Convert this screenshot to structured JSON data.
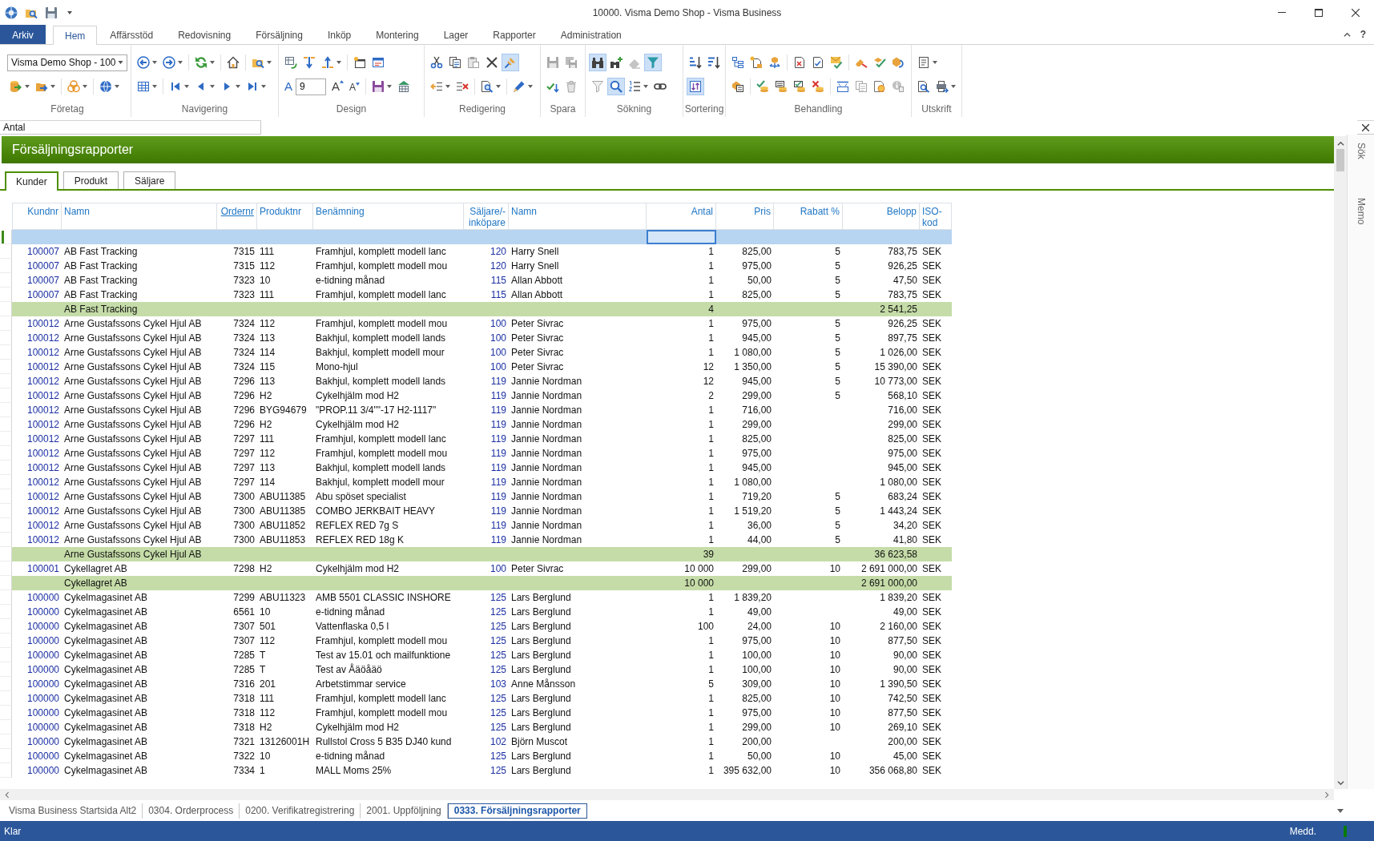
{
  "window": {
    "title": "10000. Visma Demo Shop - Visma Business"
  },
  "ribbon": {
    "tabs": [
      {
        "label": "Arkiv",
        "kind": "backstage",
        "selected": false
      },
      {
        "label": "Hem",
        "kind": "tab",
        "selected": true
      },
      {
        "label": "Affärsstöd",
        "kind": "tab",
        "selected": false
      },
      {
        "label": "Redovisning",
        "kind": "tab",
        "selected": false
      },
      {
        "label": "Försäljning",
        "kind": "tab",
        "selected": false
      },
      {
        "label": "Inköp",
        "kind": "tab",
        "selected": false
      },
      {
        "label": "Montering",
        "kind": "tab",
        "selected": false
      },
      {
        "label": "Lager",
        "kind": "tab",
        "selected": false
      },
      {
        "label": "Rapporter",
        "kind": "tab",
        "selected": false
      },
      {
        "label": "Administration",
        "kind": "tab",
        "selected": false
      }
    ],
    "help_button": "?",
    "company_select": {
      "value": "Visma Demo Shop - 100"
    },
    "font_buttons": [
      "A",
      "A",
      "A"
    ],
    "font_size_field": {
      "value": "9"
    },
    "groups": [
      "Företag",
      "Navigering",
      "Design",
      "Redigering",
      "Spara",
      "Sökning",
      "Sortering",
      "Behandling",
      "Utskrift"
    ]
  },
  "field_bar": {
    "name_box": {
      "value": "Antal"
    }
  },
  "panel": {
    "title": "Försäljningsrapporter",
    "tabs": [
      {
        "label": "Kunder",
        "selected": true
      },
      {
        "label": "Produkt",
        "selected": false
      },
      {
        "label": "Säljare",
        "selected": false
      }
    ],
    "table": {
      "columns": [
        {
          "label": "Kundnr",
          "sorted": false,
          "filter_focused": false
        },
        {
          "label": "Namn",
          "sorted": false,
          "filter_focused": false
        },
        {
          "label": "Ordernr",
          "sorted": true,
          "filter_focused": false
        },
        {
          "label": "Produktnr",
          "sorted": false,
          "filter_focused": false
        },
        {
          "label": "Benämning",
          "sorted": false,
          "filter_focused": false
        },
        {
          "label": "Säljare/-inköpare",
          "sorted": false,
          "filter_focused": false
        },
        {
          "label": "Namn",
          "sorted": false,
          "filter_focused": false
        },
        {
          "label": "Antal",
          "sorted": false,
          "filter_focused": true
        },
        {
          "label": "Pris",
          "sorted": false,
          "filter_focused": false
        },
        {
          "label": "Rabatt %",
          "sorted": false,
          "filter_focused": false
        },
        {
          "label": "Belopp",
          "sorted": false,
          "filter_focused": false
        },
        {
          "label": "ISO-kod",
          "sorted": false,
          "filter_focused": false
        }
      ],
      "rows": [
        {
          "kind": "line",
          "kundnr": "100007",
          "namn": "AB Fast Tracking",
          "ordernr": "7315",
          "produktnr": "111",
          "benamning": "Framhjul, komplett modell lanc",
          "saljare": "120",
          "saljare_namn": "Harry Snell",
          "antal": "1",
          "pris": "825,00",
          "rabatt": "5",
          "belopp": "783,75",
          "iso_kod": "SEK"
        },
        {
          "kind": "line",
          "kundnr": "100007",
          "namn": "AB Fast Tracking",
          "ordernr": "7315",
          "produktnr": "112",
          "benamning": "Framhjul, komplett modell mou",
          "saljare": "120",
          "saljare_namn": "Harry Snell",
          "antal": "1",
          "pris": "975,00",
          "rabatt": "5",
          "belopp": "926,25",
          "iso_kod": "SEK"
        },
        {
          "kind": "line",
          "kundnr": "100007",
          "namn": "AB Fast Tracking",
          "ordernr": "7323",
          "produktnr": "10",
          "benamning": "e-tidning månad",
          "saljare": "115",
          "saljare_namn": "Allan Abbott",
          "antal": "1",
          "pris": "50,00",
          "rabatt": "5",
          "belopp": "47,50",
          "iso_kod": "SEK"
        },
        {
          "kind": "line",
          "kundnr": "100007",
          "namn": "AB Fast Tracking",
          "ordernr": "7323",
          "produktnr": "111",
          "benamning": "Framhjul, komplett modell lanc",
          "saljare": "115",
          "saljare_namn": "Allan Abbott",
          "antal": "1",
          "pris": "825,00",
          "rabatt": "5",
          "belopp": "783,75",
          "iso_kod": "SEK"
        },
        {
          "kind": "subtotal",
          "namn": "AB Fast Tracking",
          "antal": "4",
          "belopp": "2 541,25"
        },
        {
          "kind": "line",
          "kundnr": "100012",
          "namn": "Arne Gustafssons Cykel Hjul AB",
          "ordernr": "7324",
          "produktnr": "112",
          "benamning": "Framhjul, komplett modell mou",
          "saljare": "100",
          "saljare_namn": "Peter Sivrac",
          "antal": "1",
          "pris": "975,00",
          "rabatt": "5",
          "belopp": "926,25",
          "iso_kod": "SEK"
        },
        {
          "kind": "line",
          "kundnr": "100012",
          "namn": "Arne Gustafssons Cykel Hjul AB",
          "ordernr": "7324",
          "produktnr": "113",
          "benamning": "Bakhjul, komplett modell lands",
          "saljare": "100",
          "saljare_namn": "Peter Sivrac",
          "antal": "1",
          "pris": "945,00",
          "rabatt": "5",
          "belopp": "897,75",
          "iso_kod": "SEK"
        },
        {
          "kind": "line",
          "kundnr": "100012",
          "namn": "Arne Gustafssons Cykel Hjul AB",
          "ordernr": "7324",
          "produktnr": "114",
          "benamning": "Bakhjul, komplett modell mour",
          "saljare": "100",
          "saljare_namn": "Peter Sivrac",
          "antal": "1",
          "pris": "1 080,00",
          "rabatt": "5",
          "belopp": "1 026,00",
          "iso_kod": "SEK"
        },
        {
          "kind": "line",
          "kundnr": "100012",
          "namn": "Arne Gustafssons Cykel Hjul AB",
          "ordernr": "7324",
          "produktnr": "115",
          "benamning": "Mono-hjul",
          "saljare": "100",
          "saljare_namn": "Peter Sivrac",
          "antal": "12",
          "pris": "1 350,00",
          "rabatt": "5",
          "belopp": "15 390,00",
          "iso_kod": "SEK"
        },
        {
          "kind": "line",
          "kundnr": "100012",
          "namn": "Arne Gustafssons Cykel Hjul AB",
          "ordernr": "7296",
          "produktnr": "113",
          "benamning": "Bakhjul, komplett modell lands",
          "saljare": "119",
          "saljare_namn": "Jannie Nordman",
          "antal": "12",
          "pris": "945,00",
          "rabatt": "5",
          "belopp": "10 773,00",
          "iso_kod": "SEK"
        },
        {
          "kind": "line",
          "kundnr": "100012",
          "namn": "Arne Gustafssons Cykel Hjul AB",
          "ordernr": "7296",
          "produktnr": "H2",
          "benamning": "Cykelhjälm mod H2",
          "saljare": "119",
          "saljare_namn": "Jannie Nordman",
          "antal": "2",
          "pris": "299,00",
          "rabatt": "5",
          "belopp": "568,10",
          "iso_kod": "SEK"
        },
        {
          "kind": "line",
          "kundnr": "100012",
          "namn": "Arne Gustafssons Cykel Hjul AB",
          "ordernr": "7296",
          "produktnr": "BYG94679",
          "benamning": "\"PROP.11 3/4\"\"-17 H2-1117\"",
          "saljare": "119",
          "saljare_namn": "Jannie Nordman",
          "antal": "1",
          "pris": "716,00",
          "belopp": "716,00",
          "iso_kod": "SEK"
        },
        {
          "kind": "line",
          "kundnr": "100012",
          "namn": "Arne Gustafssons Cykel Hjul AB",
          "ordernr": "7296",
          "produktnr": "H2",
          "benamning": "Cykelhjälm mod H2",
          "saljare": "119",
          "saljare_namn": "Jannie Nordman",
          "antal": "1",
          "pris": "299,00",
          "belopp": "299,00",
          "iso_kod": "SEK"
        },
        {
          "kind": "line",
          "kundnr": "100012",
          "namn": "Arne Gustafssons Cykel Hjul AB",
          "ordernr": "7297",
          "produktnr": "111",
          "benamning": "Framhjul, komplett modell lanc",
          "saljare": "119",
          "saljare_namn": "Jannie Nordman",
          "antal": "1",
          "pris": "825,00",
          "belopp": "825,00",
          "iso_kod": "SEK"
        },
        {
          "kind": "line",
          "kundnr": "100012",
          "namn": "Arne Gustafssons Cykel Hjul AB",
          "ordernr": "7297",
          "produktnr": "112",
          "benamning": "Framhjul, komplett modell mou",
          "saljare": "119",
          "saljare_namn": "Jannie Nordman",
          "antal": "1",
          "pris": "975,00",
          "belopp": "975,00",
          "iso_kod": "SEK"
        },
        {
          "kind": "line",
          "kundnr": "100012",
          "namn": "Arne Gustafssons Cykel Hjul AB",
          "ordernr": "7297",
          "produktnr": "113",
          "benamning": "Bakhjul, komplett modell lands",
          "saljare": "119",
          "saljare_namn": "Jannie Nordman",
          "antal": "1",
          "pris": "945,00",
          "belopp": "945,00",
          "iso_kod": "SEK"
        },
        {
          "kind": "line",
          "kundnr": "100012",
          "namn": "Arne Gustafssons Cykel Hjul AB",
          "ordernr": "7297",
          "produktnr": "114",
          "benamning": "Bakhjul, komplett modell mour",
          "saljare": "119",
          "saljare_namn": "Jannie Nordman",
          "antal": "1",
          "pris": "1 080,00",
          "belopp": "1 080,00",
          "iso_kod": "SEK"
        },
        {
          "kind": "line",
          "kundnr": "100012",
          "namn": "Arne Gustafssons Cykel Hjul AB",
          "ordernr": "7300",
          "produktnr": "ABU11385",
          "benamning": "Abu spöset specialist",
          "saljare": "119",
          "saljare_namn": "Jannie Nordman",
          "antal": "1",
          "pris": "719,20",
          "rabatt": "5",
          "belopp": "683,24",
          "iso_kod": "SEK"
        },
        {
          "kind": "line",
          "kundnr": "100012",
          "namn": "Arne Gustafssons Cykel Hjul AB",
          "ordernr": "7300",
          "produktnr": "ABU11385",
          "benamning": "COMBO JERKBAIT HEAVY",
          "saljare": "119",
          "saljare_namn": "Jannie Nordman",
          "antal": "1",
          "pris": "1 519,20",
          "rabatt": "5",
          "belopp": "1 443,24",
          "iso_kod": "SEK"
        },
        {
          "kind": "line",
          "kundnr": "100012",
          "namn": "Arne Gustafssons Cykel Hjul AB",
          "ordernr": "7300",
          "produktnr": "ABU11852",
          "benamning": "REFLEX RED 7g S",
          "saljare": "119",
          "saljare_namn": "Jannie Nordman",
          "antal": "1",
          "pris": "36,00",
          "rabatt": "5",
          "belopp": "34,20",
          "iso_kod": "SEK"
        },
        {
          "kind": "line",
          "kundnr": "100012",
          "namn": "Arne Gustafssons Cykel Hjul AB",
          "ordernr": "7300",
          "produktnr": "ABU11853",
          "benamning": "REFLEX RED 18g K",
          "saljare": "119",
          "saljare_namn": "Jannie Nordman",
          "antal": "1",
          "pris": "44,00",
          "rabatt": "5",
          "belopp": "41,80",
          "iso_kod": "SEK"
        },
        {
          "kind": "subtotal",
          "namn": "Arne Gustafssons Cykel Hjul AB",
          "antal": "39",
          "belopp": "36 623,58"
        },
        {
          "kind": "line",
          "kundnr": "100001",
          "namn": "Cykellagret AB",
          "ordernr": "7298",
          "produktnr": "H2",
          "benamning": "Cykelhjälm mod H2",
          "saljare": "100",
          "saljare_namn": "Peter Sivrac",
          "antal": "10 000",
          "pris": "299,00",
          "rabatt": "10",
          "belopp": "2 691 000,00",
          "iso_kod": "SEK"
        },
        {
          "kind": "subtotal",
          "namn": "Cykellagret AB",
          "antal": "10 000",
          "belopp": "2 691 000,00"
        },
        {
          "kind": "line",
          "kundnr": "100000",
          "namn": "Cykelmagasinet AB",
          "ordernr": "7299",
          "produktnr": "ABU11323",
          "benamning": "AMB 5501 CLASSIC INSHORE",
          "saljare": "125",
          "saljare_namn": "Lars Berglund",
          "antal": "1",
          "pris": "1 839,20",
          "belopp": "1 839,20",
          "iso_kod": "SEK"
        },
        {
          "kind": "line",
          "kundnr": "100000",
          "namn": "Cykelmagasinet AB",
          "ordernr": "6561",
          "produktnr": "10",
          "benamning": "e-tidning månad",
          "saljare": "125",
          "saljare_namn": "Lars Berglund",
          "antal": "1",
          "pris": "49,00",
          "belopp": "49,00",
          "iso_kod": "SEK"
        },
        {
          "kind": "line",
          "kundnr": "100000",
          "namn": "Cykelmagasinet AB",
          "ordernr": "7307",
          "produktnr": "501",
          "benamning": "Vattenflaska 0,5 l",
          "saljare": "125",
          "saljare_namn": "Lars Berglund",
          "antal": "100",
          "pris": "24,00",
          "rabatt": "10",
          "belopp": "2 160,00",
          "iso_kod": "SEK"
        },
        {
          "kind": "line",
          "kundnr": "100000",
          "namn": "Cykelmagasinet AB",
          "ordernr": "7307",
          "produktnr": "112",
          "benamning": "Framhjul, komplett modell mou",
          "saljare": "125",
          "saljare_namn": "Lars Berglund",
          "antal": "1",
          "pris": "975,00",
          "rabatt": "10",
          "belopp": "877,50",
          "iso_kod": "SEK"
        },
        {
          "kind": "line",
          "kundnr": "100000",
          "namn": "Cykelmagasinet AB",
          "ordernr": "7285",
          "produktnr": "T",
          "benamning": "Test av 15.01 och mailfunktione",
          "saljare": "125",
          "saljare_namn": "Lars Berglund",
          "antal": "1",
          "pris": "100,00",
          "rabatt": "10",
          "belopp": "90,00",
          "iso_kod": "SEK"
        },
        {
          "kind": "line",
          "kundnr": "100000",
          "namn": "Cykelmagasinet AB",
          "ordernr": "7285",
          "produktnr": "T",
          "benamning": "Test av Åäöåäö",
          "saljare": "125",
          "saljare_namn": "Lars Berglund",
          "antal": "1",
          "pris": "100,00",
          "rabatt": "10",
          "belopp": "90,00",
          "iso_kod": "SEK"
        },
        {
          "kind": "line",
          "kundnr": "100000",
          "namn": "Cykelmagasinet AB",
          "ordernr": "7316",
          "produktnr": "201",
          "benamning": "Arbetstimmar service",
          "saljare": "103",
          "saljare_namn": "Anne Månsson",
          "antal": "5",
          "pris": "309,00",
          "rabatt": "10",
          "belopp": "1 390,50",
          "iso_kod": "SEK"
        },
        {
          "kind": "line",
          "kundnr": "100000",
          "namn": "Cykelmagasinet AB",
          "ordernr": "7318",
          "produktnr": "111",
          "benamning": "Framhjul, komplett modell lanc",
          "saljare": "125",
          "saljare_namn": "Lars Berglund",
          "antal": "1",
          "pris": "825,00",
          "rabatt": "10",
          "belopp": "742,50",
          "iso_kod": "SEK"
        },
        {
          "kind": "line",
          "kundnr": "100000",
          "namn": "Cykelmagasinet AB",
          "ordernr": "7318",
          "produktnr": "112",
          "benamning": "Framhjul, komplett modell mou",
          "saljare": "125",
          "saljare_namn": "Lars Berglund",
          "antal": "1",
          "pris": "975,00",
          "rabatt": "10",
          "belopp": "877,50",
          "iso_kod": "SEK"
        },
        {
          "kind": "line",
          "kundnr": "100000",
          "namn": "Cykelmagasinet AB",
          "ordernr": "7318",
          "produktnr": "H2",
          "benamning": "Cykelhjälm mod H2",
          "saljare": "125",
          "saljare_namn": "Lars Berglund",
          "antal": "1",
          "pris": "299,00",
          "rabatt": "10",
          "belopp": "269,10",
          "iso_kod": "SEK"
        },
        {
          "kind": "line",
          "kundnr": "100000",
          "namn": "Cykelmagasinet AB",
          "ordernr": "7321",
          "produktnr": "13126001H",
          "benamning": "Rullstol Cross 5 B35 DJ40 kund",
          "saljare": "102",
          "saljare_namn": "Björn Muscot",
          "antal": "1",
          "pris": "200,00",
          "belopp": "200,00",
          "iso_kod": "SEK"
        },
        {
          "kind": "line",
          "kundnr": "100000",
          "namn": "Cykelmagasinet AB",
          "ordernr": "7322",
          "produktnr": "10",
          "benamning": "e-tidning månad",
          "saljare": "125",
          "saljare_namn": "Lars Berglund",
          "antal": "1",
          "pris": "50,00",
          "rabatt": "10",
          "belopp": "45,00",
          "iso_kod": "SEK"
        },
        {
          "kind": "line",
          "kundnr": "100000",
          "namn": "Cykelmagasinet AB",
          "ordernr": "7334",
          "produktnr": "1",
          "benamning": "MALL Moms 25%",
          "saljare": "125",
          "saljare_namn": "Lars Berglund",
          "antal": "1",
          "pris": "395 632,00",
          "rabatt": "10",
          "belopp": "356 068,80",
          "iso_kod": "SEK"
        }
      ]
    }
  },
  "side_pane": {
    "tabs": [
      "Sök",
      "Memo"
    ]
  },
  "document_tabs": [
    {
      "label": "Visma Business Startsida Alt2",
      "selected": false
    },
    {
      "label": "0304. Orderprocess",
      "selected": false
    },
    {
      "label": "0200. Verifikatregistrering",
      "selected": false
    },
    {
      "label": "2001. Uppföljning",
      "selected": false
    },
    {
      "label": "0333. Försäljningsrapporter",
      "selected": true
    }
  ],
  "status_bar": {
    "text": "Klar",
    "messages": "Medd."
  }
}
